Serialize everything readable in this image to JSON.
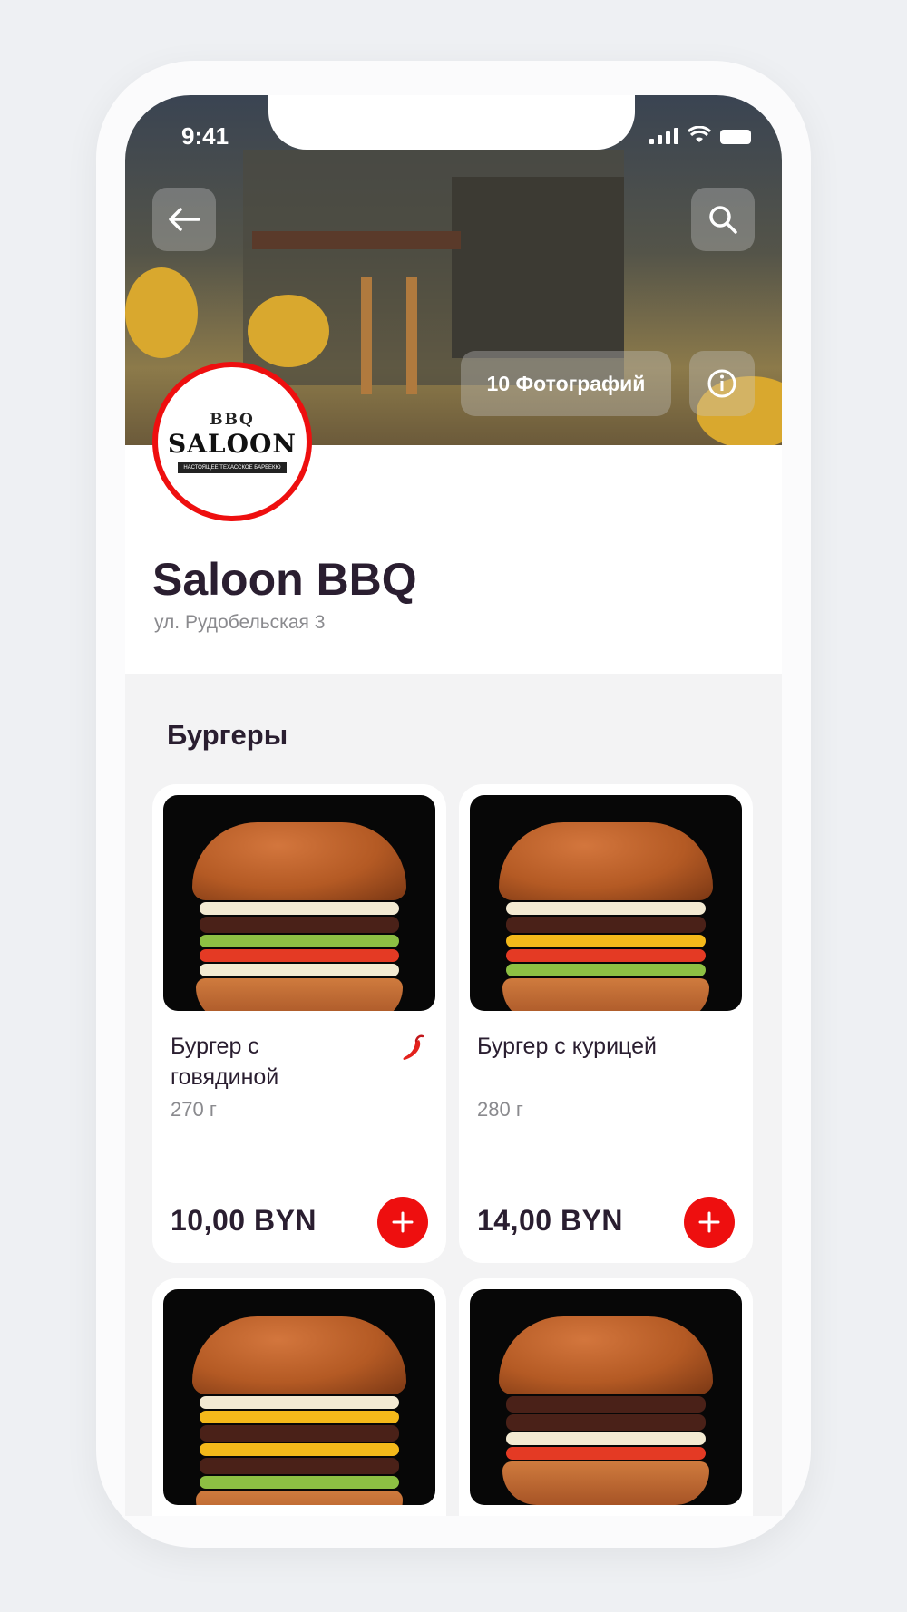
{
  "status_bar": {
    "time": "9:41"
  },
  "restaurant": {
    "photos_label": "10 Фотографий",
    "logo": {
      "top": "BBQ",
      "name": "SALOON",
      "tagline": "НАСТОЯЩЕЕ ТЕХАССКОЕ БАРБЕКЮ"
    },
    "name": "Saloon BBQ",
    "address": "ул. Рудобельская 3"
  },
  "menu": {
    "section_title": "Бургеры",
    "items": [
      {
        "name": "Бургер с говядиной",
        "weight": "270 г",
        "price": "10,00 BYN",
        "spicy": true
      },
      {
        "name": "Бургер с курицей",
        "weight": "280 г",
        "price": "14,00 BYN",
        "spicy": false
      },
      {
        "name": "",
        "weight": "",
        "price": "",
        "spicy": false
      },
      {
        "name": "",
        "weight": "",
        "price": "",
        "spicy": false
      }
    ]
  },
  "colors": {
    "accent": "#ee0f0f",
    "text_primary": "#2a1e30",
    "text_secondary": "#8a8a8e",
    "menu_background": "#f3f3f4"
  },
  "icons": [
    "back-arrow-icon",
    "search-icon",
    "info-icon",
    "spicy-pepper-icon",
    "plus-icon"
  ]
}
